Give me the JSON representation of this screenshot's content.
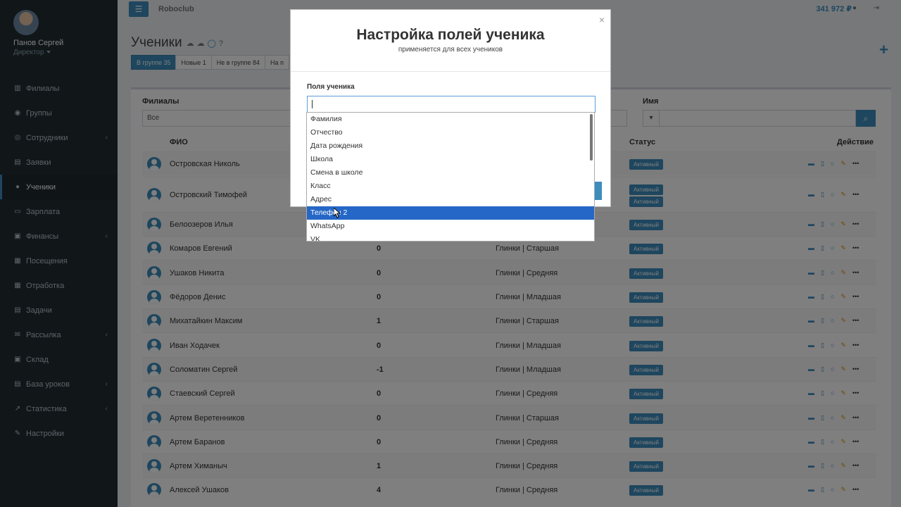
{
  "user": {
    "name": "Панов Сергей",
    "role": "Директор"
  },
  "sidebar": {
    "items": [
      {
        "label": "Филиалы",
        "icon": "bank-icon",
        "chevron": false
      },
      {
        "label": "Группы",
        "icon": "users-icon",
        "chevron": false
      },
      {
        "label": "Сотрудники",
        "icon": "user-circle-icon",
        "chevron": true
      },
      {
        "label": "Заявки",
        "icon": "book-icon",
        "chevron": false
      },
      {
        "label": "Ученики",
        "icon": "user-icon",
        "chevron": false,
        "active": true
      },
      {
        "label": "Зарплата",
        "icon": "credit-card-icon",
        "chevron": false
      },
      {
        "label": "Финансы",
        "icon": "money-icon",
        "chevron": true
      },
      {
        "label": "Посещения",
        "icon": "calendar-icon",
        "chevron": false
      },
      {
        "label": "Отработка",
        "icon": "calendar-check-icon",
        "chevron": false
      },
      {
        "label": "Задачи",
        "icon": "briefcase-icon",
        "chevron": false
      },
      {
        "label": "Рассылка",
        "icon": "envelope-icon",
        "chevron": true
      },
      {
        "label": "Склад",
        "icon": "archive-icon",
        "chevron": false
      },
      {
        "label": "База уроков",
        "icon": "database-icon",
        "chevron": true
      },
      {
        "label": "Статистика",
        "icon": "line-chart-icon",
        "chevron": true
      },
      {
        "label": "Настройки",
        "icon": "wrench-icon",
        "chevron": false
      }
    ]
  },
  "header": {
    "brand": "Roboclub",
    "balance": "341 972 ₽"
  },
  "page": {
    "title": "Ученики",
    "tabs": [
      {
        "label": "В группе 35",
        "active": true
      },
      {
        "label": "Новые 1",
        "active": false
      },
      {
        "label": "Не в группе 84",
        "active": false
      },
      {
        "label": "На п",
        "active": false
      }
    ]
  },
  "filters": {
    "branch_label": "Филиалы",
    "branch_value": "Все",
    "name_label": "Имя"
  },
  "table": {
    "headers": {
      "name": "ФИО",
      "status": "Статус",
      "action": "Действие"
    },
    "rows": [
      {
        "name": "Островская Николь",
        "num": "",
        "group": "",
        "status": [
          "Активный"
        ]
      },
      {
        "name": "Островский Тимофей",
        "num": "",
        "group": "",
        "status": [
          "Активный",
          "Активный"
        ]
      },
      {
        "name": "Белоозеров Илья",
        "num": "",
        "group": "",
        "status": [
          "Активный"
        ]
      },
      {
        "name": "Комаров Евгений",
        "num": "0",
        "group": "Глинки | Старшая",
        "status": [
          "Активный"
        ]
      },
      {
        "name": "Ушаков Никита",
        "num": "0",
        "group": "Глинки | Средняя",
        "status": [
          "Активный"
        ]
      },
      {
        "name": "Фёдоров Денис",
        "num": "0",
        "group": "Глинки | Младшая",
        "status": [
          "Активный"
        ]
      },
      {
        "name": "Михатайкин Максим",
        "num": "1",
        "group": "Глинки | Старшая",
        "status": [
          "Активный"
        ]
      },
      {
        "name": "Иван Ходачек",
        "num": "0",
        "group": "Глинки | Младшая",
        "status": [
          "Активный"
        ]
      },
      {
        "name": "Соломатин Сергей",
        "num": "-1",
        "group": "Глинки | Младшая",
        "status": [
          "Активный"
        ]
      },
      {
        "name": "Стаевский Сергей",
        "num": "0",
        "group": "Глинки | Средняя",
        "status": [
          "Активный"
        ]
      },
      {
        "name": "Артем Веретенников",
        "num": "0",
        "group": "Глинки | Старшая",
        "status": [
          "Активный"
        ]
      },
      {
        "name": "Артем Баранов",
        "num": "0",
        "group": "Глинки | Средняя",
        "status": [
          "Активный"
        ]
      },
      {
        "name": "Артем Химаныч",
        "num": "1",
        "group": "Глинки | Средняя",
        "status": [
          "Активный"
        ]
      },
      {
        "name": "Алексей Ушаков",
        "num": "4",
        "group": "Глинки | Средняя",
        "status": [
          "Активный"
        ]
      }
    ]
  },
  "modal": {
    "title": "Настройка полей ученика",
    "subtitle": "применяется для всех учеников",
    "close": "×",
    "field_label": "Поля ученика",
    "input_value": "",
    "options": [
      "Фамилия",
      "Отчество",
      "Дата рождения",
      "Школа",
      "Смена в школе",
      "Класс",
      "Адрес",
      "Телефон 2",
      "WhatsApp",
      "VK"
    ],
    "selected_option": "Телефон 2"
  },
  "colors": {
    "accent": "#3c8dbc",
    "sidebar": "#222d32",
    "selected": "#2567c6"
  }
}
